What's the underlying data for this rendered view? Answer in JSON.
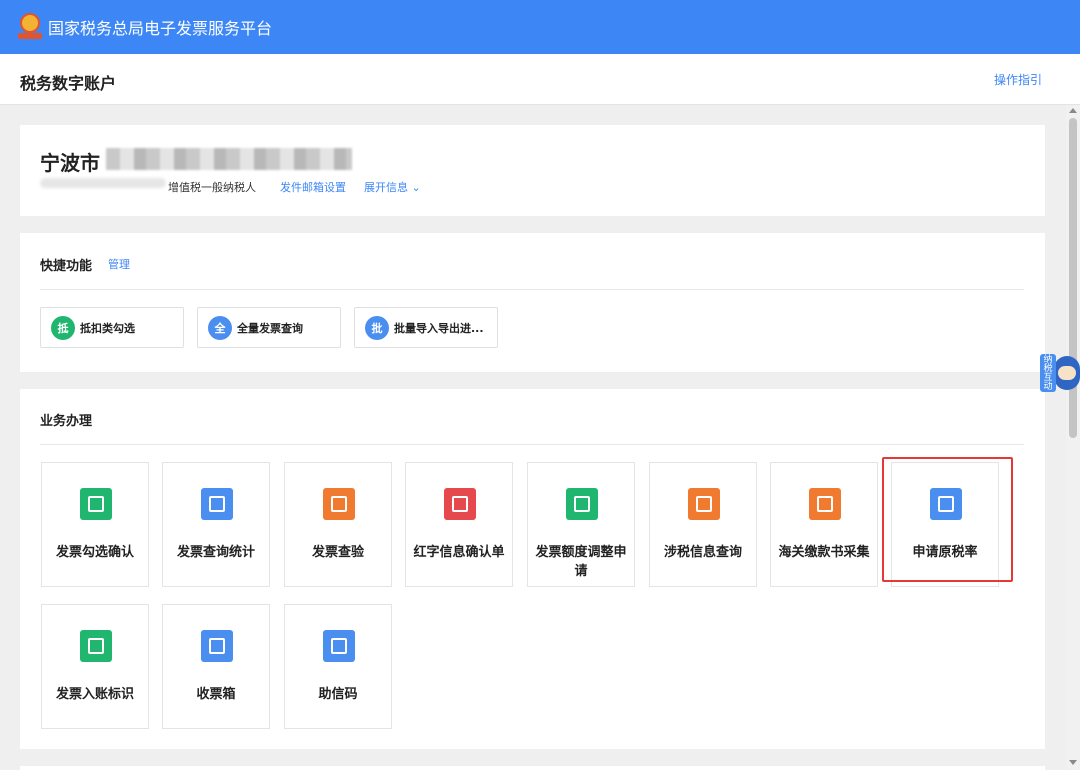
{
  "header": {
    "platform_title": "国家税务总局电子发票服务平台",
    "brand_color": "#3d86f5"
  },
  "subheader": {
    "title": "税务数字账户",
    "guide_link": "操作指引"
  },
  "account": {
    "company_name": "宁波市",
    "taxpayer_type": "增值税一般纳税人",
    "mail_settings_link": "发件邮箱设置",
    "expand_link": "展开信息 ⌄"
  },
  "quick": {
    "title": "快捷功能",
    "manage_link": "管理",
    "items": [
      {
        "icon_char": "抵",
        "label": "抵扣类勾选",
        "color": "#21b66f"
      },
      {
        "icon_char": "全",
        "label": "全量发票查询",
        "color": "#4a8ef0"
      },
      {
        "icon_char": "批",
        "label": "批量导入导出进...",
        "color": "#4a8ef0"
      }
    ]
  },
  "business": {
    "title": "业务办理",
    "items": [
      {
        "label": "发票勾选确认",
        "icon": "ticket-icon",
        "color": "#21b66f"
      },
      {
        "label": "发票查询统计",
        "icon": "search-doc-icon",
        "color": "#4a8ef0"
      },
      {
        "label": "发票查验",
        "icon": "verify-icon",
        "color": "#f07a30"
      },
      {
        "label": "红字信息确认单",
        "icon": "red-doc-icon",
        "color": "#e5484d"
      },
      {
        "label": "发票额度调整申请",
        "icon": "edit-doc-icon",
        "color": "#21b66f"
      },
      {
        "label": "涉税信息查询",
        "icon": "info-search-icon",
        "color": "#f07a30"
      },
      {
        "label": "海关缴款书采集",
        "icon": "customs-icon",
        "color": "#f07a30"
      },
      {
        "label": "申请原税率",
        "icon": "apply-icon",
        "color": "#4a8ef0"
      },
      {
        "label": "发票入账标识",
        "icon": "account-mark-icon",
        "color": "#21b66f"
      },
      {
        "label": "收票箱",
        "icon": "inbox-icon",
        "color": "#4a8ef0"
      },
      {
        "label": "助信码",
        "icon": "qrcode-icon",
        "color": "#4a8ef0"
      }
    ]
  },
  "mascot": {
    "text": "纳税互动"
  }
}
